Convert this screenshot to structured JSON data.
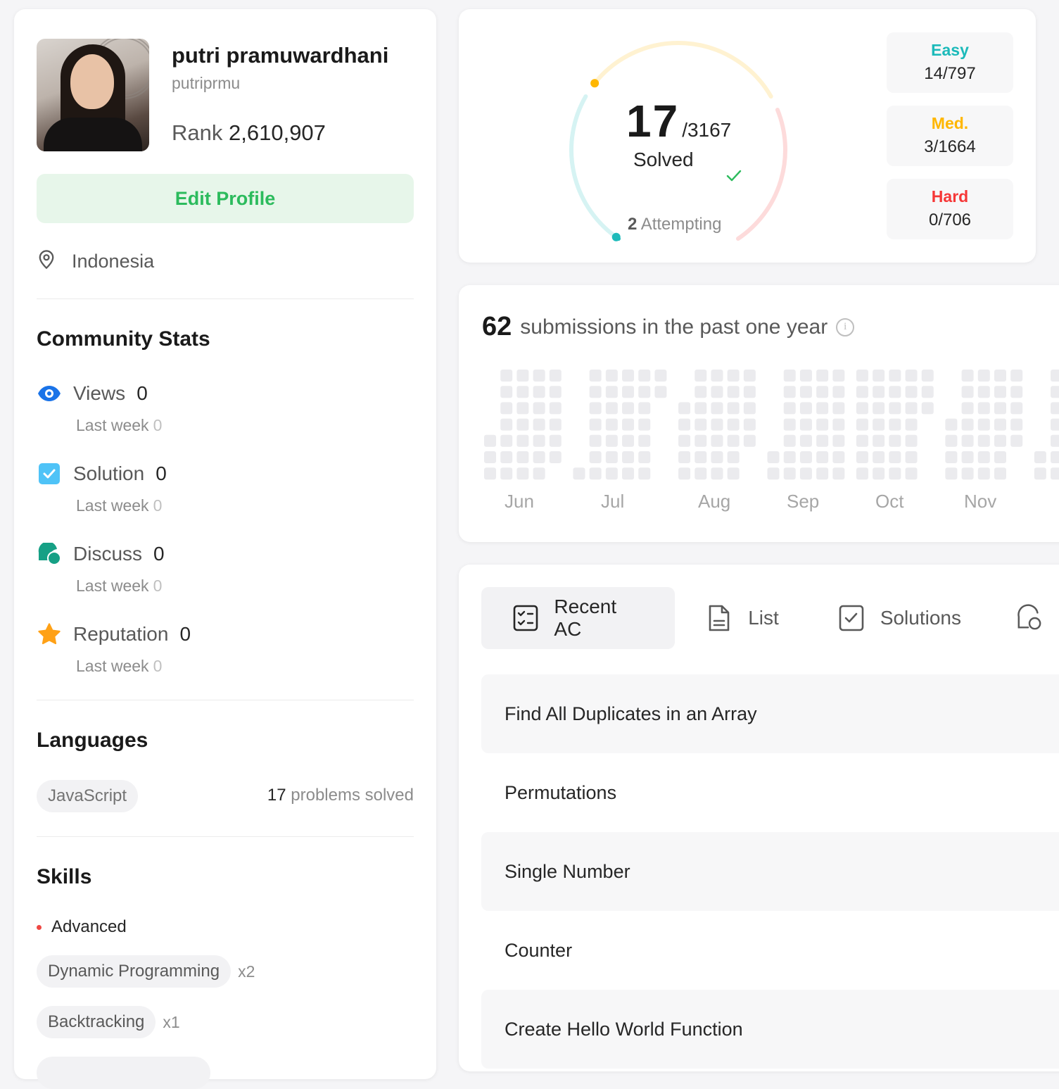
{
  "profile": {
    "name": "putri pramuwardhani",
    "username": "putriprmu",
    "rank_label": "Rank",
    "rank_value": "2,610,907",
    "edit_label": "Edit Profile",
    "location": "Indonesia"
  },
  "community": {
    "title": "Community Stats",
    "last_week_label": "Last week",
    "items": [
      {
        "label": "Views",
        "value": "0",
        "last_week": "0",
        "icon": "eye-icon",
        "color": "#1a73e8"
      },
      {
        "label": "Solution",
        "value": "0",
        "last_week": "0",
        "icon": "checkbox-icon",
        "color": "#4fc3f7"
      },
      {
        "label": "Discuss",
        "value": "0",
        "last_week": "0",
        "icon": "discuss-icon",
        "color": "#16a085"
      },
      {
        "label": "Reputation",
        "value": "0",
        "last_week": "0",
        "icon": "star-icon",
        "color": "#ffa116"
      }
    ]
  },
  "languages": {
    "title": "Languages",
    "items": [
      {
        "name": "JavaScript",
        "count": "17",
        "suffix": "problems solved"
      }
    ]
  },
  "skills": {
    "title": "Skills",
    "level": "Advanced",
    "items": [
      {
        "name": "Dynamic Programming",
        "count": "x2"
      },
      {
        "name": "Backtracking",
        "count": "x1"
      }
    ]
  },
  "solved": {
    "count": "17",
    "total": "/3167",
    "label": "Solved",
    "attempting_count": "2",
    "attempting_label": "Attempting",
    "difficulties": [
      {
        "label": "Easy",
        "solved": 14,
        "total": 797,
        "text": "14/797",
        "color": "#1cbaba"
      },
      {
        "label": "Med.",
        "solved": 3,
        "total": 1664,
        "text": "3/1664",
        "color": "#ffb700"
      },
      {
        "label": "Hard",
        "solved": 0,
        "total": 706,
        "text": "0/706",
        "color": "#f63737"
      }
    ]
  },
  "submissions": {
    "count": "62",
    "label": "submissions in the past one year",
    "months": [
      "Jun",
      "Jul",
      "Aug",
      "Sep",
      "Oct",
      "Nov"
    ]
  },
  "tabs": [
    {
      "label": "Recent AC",
      "icon": "recent-ac-icon",
      "active": true
    },
    {
      "label": "List",
      "icon": "list-icon",
      "active": false
    },
    {
      "label": "Solutions",
      "icon": "solutions-icon",
      "active": false
    }
  ],
  "problems": [
    "Find All Duplicates in an Array",
    "Permutations",
    "Single Number",
    "Counter",
    "Create Hello World Function"
  ]
}
